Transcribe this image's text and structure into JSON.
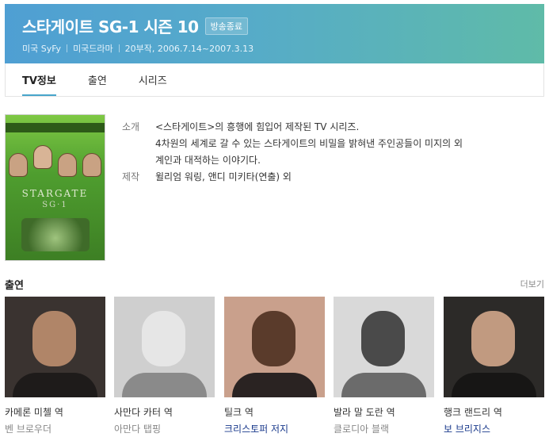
{
  "header": {
    "title": "스타게이트 SG-1 시즌 10",
    "badge": "방송종료",
    "meta": [
      "미국 SyFy",
      "미국드라마",
      "20부작, 2006.7.14~2007.3.13"
    ]
  },
  "tabs": [
    {
      "label": "TV정보",
      "active": true
    },
    {
      "label": "출연",
      "active": false
    },
    {
      "label": "시리즈",
      "active": false
    }
  ],
  "poster": {
    "band_text": "RICHARD DEAN ANDERSON",
    "title": "STARGATE",
    "subtitle": "SG·1"
  },
  "info": {
    "intro_label": "소개",
    "intro_lines": [
      "<스타게이트>의 흥행에 힘입어 제작된 TV 시리즈.",
      "4차원의 세계로 갈 수 있는 스타게이트의 비밀을 밝혀낸 주인공들이 미지의 외",
      "계인과 대적하는 이야기다."
    ],
    "production_label": "제작",
    "production_text": "윌리엄 워링, 앤디 미키타(연출) 외"
  },
  "cast_section": {
    "title": "출연",
    "more": "더보기"
  },
  "cast": [
    {
      "role": "카메론 미첼 역",
      "actor": "벤 브로우더",
      "actor_style": "gray"
    },
    {
      "role": "사만다 카터 역",
      "actor": "아만다 탭핑",
      "actor_style": "gray"
    },
    {
      "role": "틸크 역",
      "actor": "크리스토퍼 저지",
      "actor_style": "blue"
    },
    {
      "role": "발라 말 도란 역",
      "actor": "클로디아 블랙",
      "actor_style": "gray"
    },
    {
      "role": "행크 랜드리 역",
      "actor": "보 브리지스",
      "actor_style": "blue"
    }
  ],
  "colors": {
    "header_start": "#4f9fd3",
    "header_end": "#5fbba8",
    "tab_underline": "#48a5cb",
    "link_blue": "#1a3a8c"
  }
}
